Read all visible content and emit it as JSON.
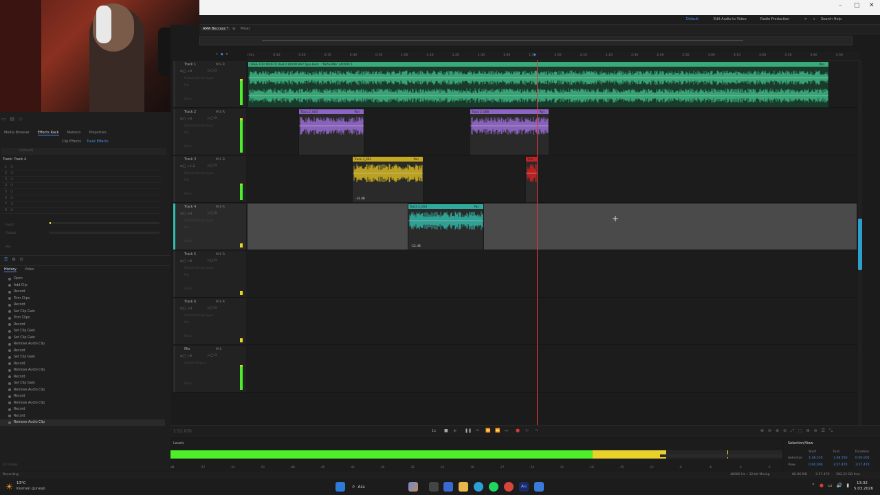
{
  "window": {
    "title_right": "Search Help",
    "workspaces": [
      "Default",
      "Edit Audio to Video",
      "Radio Production"
    ],
    "controls": [
      "–",
      "▢",
      "✕"
    ]
  },
  "session": {
    "tab_label": "AMA Beccasz *",
    "mixer_label": "Mixer"
  },
  "left_panel": {
    "top_tabs": [
      "Media Browser",
      "Effects Rack",
      "Markers",
      "Properties"
    ],
    "active_top_tab": "Effects Rack",
    "sub_tabs": [
      "Clip Effects",
      "Track Effects"
    ],
    "active_sub_tab": "Track Effects",
    "preset_label": "(Default)",
    "track_label": "Track: Track 4",
    "rack_slots": [
      "1",
      "2",
      "3",
      "4",
      "5",
      "6",
      "7",
      "8"
    ],
    "io_labels": [
      "Input",
      "Output"
    ],
    "mix_label": "Mix",
    "history_tabs": [
      "History",
      "Video"
    ],
    "history_items": [
      "Open",
      "Add Clip",
      "Record",
      "Trim Clips",
      "Record",
      "Set Clip Gain",
      "Trim Clips",
      "Record",
      "Set Clip Gain",
      "Set Clip Gain",
      "Remove Audio Clip",
      "Record",
      "Set Clip Gain",
      "Record",
      "Remove Audio Clip",
      "Record",
      "Set Clip Gain",
      "Remove Audio Clip",
      "Record",
      "Remove Audio Clip",
      "Record",
      "Record",
      "Remove Audio Clip"
    ],
    "history_footer": "22 Undos"
  },
  "ruler": {
    "unit": "hms",
    "ticks": [
      "hms",
      "0:10",
      "0:20",
      "0:30",
      "0:40",
      "0:50",
      "1:00",
      "1:10",
      "1:20",
      "1:30",
      "1:40",
      "1:50",
      "2:00",
      "2:10",
      "2:20",
      "2:30",
      "2:40",
      "2:50",
      "3:00",
      "3:10",
      "3:20",
      "3:30",
      "3:40",
      "3:50"
    ]
  },
  "tracks": [
    {
      "name": "Track 1",
      "volume": "+0",
      "input": "Default Stereo Input",
      "output": "Mix",
      "read": "Read",
      "color": "#3fbf8a"
    },
    {
      "name": "Track 2",
      "volume": "+0",
      "input": "Default Stereo Input",
      "output": "Mix",
      "read": "Read",
      "color": "#a070e0"
    },
    {
      "name": "Track 3",
      "volume": "+1.2",
      "input": "Default Stereo Input",
      "output": "Mix",
      "read": "Read",
      "color": "#e0c020"
    },
    {
      "name": "Track 4",
      "volume": "+0",
      "input": "Default Stereo Input",
      "output": "Mix",
      "read": "Read",
      "color": "#30c0b0"
    },
    {
      "name": "Track 5",
      "volume": "+0",
      "input": "Default Stereo Input",
      "output": "Mix",
      "read": "Read",
      "color": "#888888"
    },
    {
      "name": "Track 6",
      "volume": "+0",
      "input": "Default Stereo Input",
      "output": "Mix",
      "read": "Read",
      "color": "#888888"
    },
    {
      "name": "Mix",
      "volume": "+0",
      "input": "Default Output",
      "output": "",
      "read": "Read",
      "color": "#888888"
    }
  ],
  "clips": [
    {
      "label": "[FREE FOR PROFIT] R&B X BOOM BAP Type Beat - \"REASONS\" (#0000 1",
      "pan": "Pan",
      "color": "#3fbf8a"
    },
    {
      "label": "Track 2_003",
      "pan": "Pan",
      "color": "#a070e0"
    },
    {
      "label": "Track 2_008",
      "pan": "Pan",
      "color": "#a070e0"
    },
    {
      "label": "Track 3_002",
      "pan": "Pan",
      "gain": "-14 dB",
      "color": "#e0c020"
    },
    {
      "label": "Trac",
      "pan": "",
      "color": "#e02020"
    },
    {
      "label": "Track 4_004",
      "pan": "Pan",
      "gain": "-12 dB",
      "color": "#30c0b0"
    }
  ],
  "transport": {
    "time": "1:52.970",
    "speed": "1x"
  },
  "levels": {
    "label": "Levels",
    "scale": [
      "dB",
      "-57",
      "-54",
      "-51",
      "-48",
      "-45",
      "-42",
      "-39",
      "-36",
      "-33",
      "-30",
      "-27",
      "-24",
      "-21",
      "-18",
      "-15",
      "-12",
      "-9",
      "-6",
      "-3",
      "0"
    ],
    "level_fraction_green": 0.69,
    "level_fraction_yellow": 0.81,
    "peak_fraction": 0.91,
    "green": "#4cef2a",
    "yellow": "#e8d22a"
  },
  "selection_view": {
    "label": "Selection/View",
    "headers": [
      "Start",
      "End",
      "Duration"
    ],
    "selection": [
      "1:48.550",
      "1:48.550",
      "0:00.000"
    ],
    "view": [
      "0:00.000",
      "3:57.470",
      "3:57.470"
    ]
  },
  "status": {
    "left": "Recording",
    "format": "48000 Hz • 32-bit Mixing",
    "size": "86.96 MB",
    "duration": "3:57.470",
    "free": "282.22 GB free"
  },
  "taskbar": {
    "weather_temp": "13°C",
    "weather_desc": "Kısmen güneşli",
    "search": "Ara",
    "time": "13:32",
    "date": "5.03.2026"
  }
}
